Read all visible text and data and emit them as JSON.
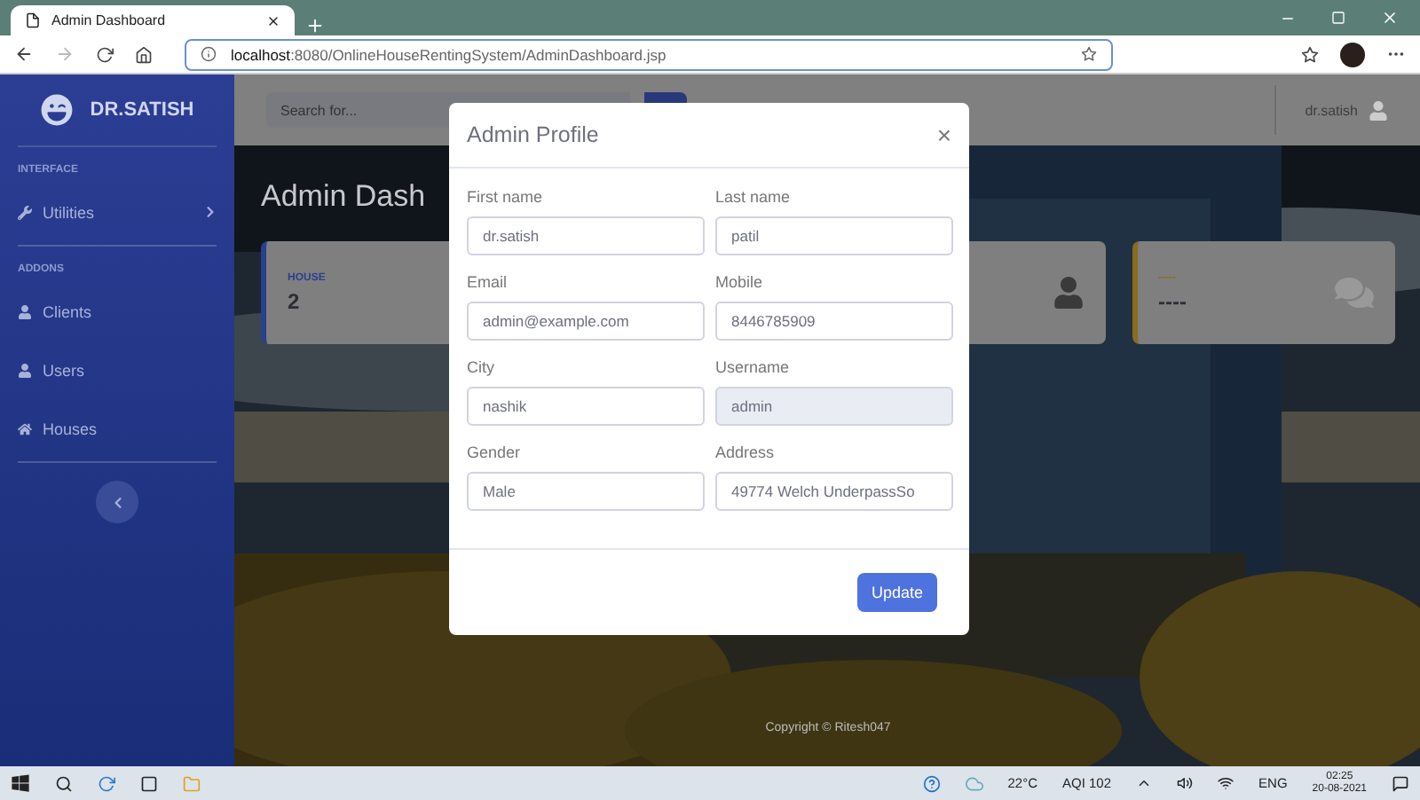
{
  "browser": {
    "tab_title": "Admin Dashboard",
    "url_host": "localhost",
    "url_rest": ":8080/OnlineHouseRentingSystem/AdminDashboard.jsp"
  },
  "sidebar": {
    "brand": "DR.SATISH",
    "sections": [
      {
        "heading": "INTERFACE",
        "items": [
          {
            "label": "Utilities",
            "kind": "collapsible"
          }
        ]
      },
      {
        "heading": "ADDONS",
        "items": [
          {
            "label": "Clients",
            "kind": "link"
          },
          {
            "label": "Users",
            "kind": "link"
          },
          {
            "label": "Houses",
            "kind": "link"
          }
        ]
      }
    ]
  },
  "topbar": {
    "search": {
      "placeholder": "Search for..."
    },
    "user": "dr.satish"
  },
  "heading": "Admin Dash",
  "cards": [
    {
      "label": "HOUSE",
      "value": "2",
      "color": "#2a3f8f"
    },
    {
      "kind": "icon"
    },
    {
      "label": "-----",
      "value": "----",
      "color": "#8a6c1e"
    }
  ],
  "footer": "Copyright © Ritesh047",
  "modal": {
    "title": "Admin Profile",
    "close": "×",
    "fields": [
      {
        "label": "First name",
        "value": "dr.satish",
        "disabled": false
      },
      {
        "label": "Last name",
        "value": "patil",
        "disabled": false
      },
      {
        "label": "Email",
        "value": "admin@example.com",
        "disabled": false
      },
      {
        "label": "Mobile",
        "value": "8446785909",
        "disabled": false
      },
      {
        "label": "City",
        "value": "nashik",
        "disabled": false
      },
      {
        "label": "Username",
        "value": "admin",
        "disabled": true
      },
      {
        "label": "Gender",
        "value": "Male",
        "disabled": false
      },
      {
        "label": "Address",
        "value": "49774 Welch UnderpassSo",
        "disabled": false
      }
    ],
    "button": "Update"
  },
  "taskbar": {
    "temperature": "22°C",
    "aqi": "AQI 102",
    "language": "ENG",
    "time": "02:25",
    "date": "20-08-2021"
  }
}
